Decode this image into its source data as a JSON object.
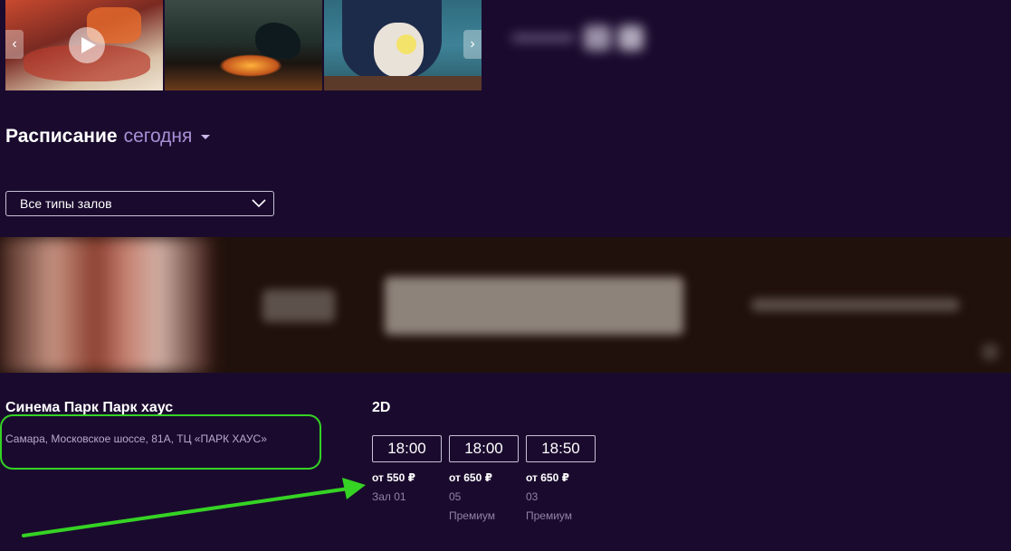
{
  "schedule": {
    "title": "Расписание",
    "day": "сегодня"
  },
  "hall_filter": {
    "selected": "Все типы залов"
  },
  "cinema": {
    "name": "Синема Парк Парк хаус",
    "address": "Самара, Московское шоссе, 81А, ТЦ «ПАРК ХАУС»"
  },
  "sessions": {
    "format": "2D",
    "items": [
      {
        "time": "18:00",
        "price": "от 550 ₽",
        "hall": "Зал 01",
        "tier": ""
      },
      {
        "time": "18:00",
        "price": "от 650 ₽",
        "hall": "05",
        "tier": "Премиум"
      },
      {
        "time": "18:50",
        "price": "от 650 ₽",
        "hall": "03",
        "tier": "Премиум"
      }
    ]
  },
  "colors": {
    "background": "#1a0b2e",
    "accent": "#a98fd6",
    "annotation": "#35d324"
  }
}
